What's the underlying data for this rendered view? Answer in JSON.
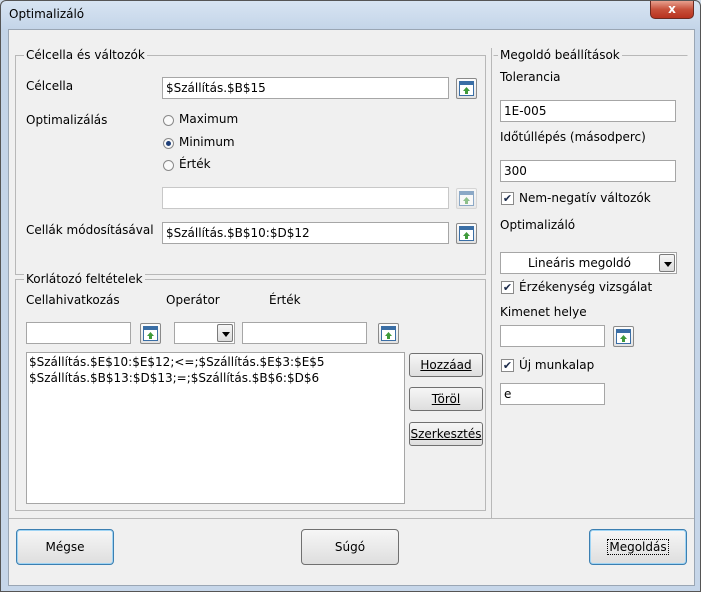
{
  "window": {
    "title": "Optimalizáló",
    "close_label": "x"
  },
  "target_group": {
    "title": "Célcella és változók",
    "target_label": "Célcella",
    "target_value": "$Szállítás.$B$15",
    "optimize_label": "Optimalizálás",
    "options": {
      "maximum": "Maximum",
      "minimum": "Minimum",
      "value": "Érték"
    },
    "selected": "minimum",
    "value_field": "",
    "changing_label": "Cellák módosításával",
    "changing_value": "$Szállítás.$B$10:$D$12"
  },
  "constraints_group": {
    "title": "Korlátozó feltételek",
    "headers": {
      "cell_ref": "Cellahivatkozás",
      "operator": "Operátor",
      "value": "Érték"
    },
    "cell_ref_value": "",
    "operator_value": "",
    "value_value": "",
    "list": [
      "$Szállítás.$E$10:$E$12;<=;$Szállítás.$E$3:$E$5",
      "$Szállítás.$B$13:$D$13;=;$Szállítás.$B$6:$D$6"
    ],
    "buttons": {
      "add": "Hozzáad",
      "remove": "Töröl",
      "edit": "Szerkesztés"
    }
  },
  "settings_group": {
    "title": "Megoldó beállítások",
    "tolerance_label": "Tolerancia",
    "tolerance_value": "1E-005",
    "timeout_label": "Időtúllépés (másodperc)",
    "timeout_value": "300",
    "nonneg_label": "Nem-negatív változók",
    "nonneg_checked": true,
    "solver_label": "Optimalizáló",
    "solver_value": "Lineáris megoldó",
    "sensitivity_label": "Érzékenység vizsgálat",
    "sensitivity_checked": true,
    "output_label": "Kimenet helye",
    "output_value": "",
    "new_sheet_label": "Új munkalap",
    "new_sheet_checked": true,
    "sheet_name_value": "e"
  },
  "footer": {
    "cancel": "Mégse",
    "help": "Súgó",
    "solve": "Megoldás"
  },
  "colors": {
    "accent": "#3c7fb1",
    "window_frame": "#cfdbe8",
    "dialog_bg": "#f0f0f0",
    "close_red": "#c7503a"
  }
}
